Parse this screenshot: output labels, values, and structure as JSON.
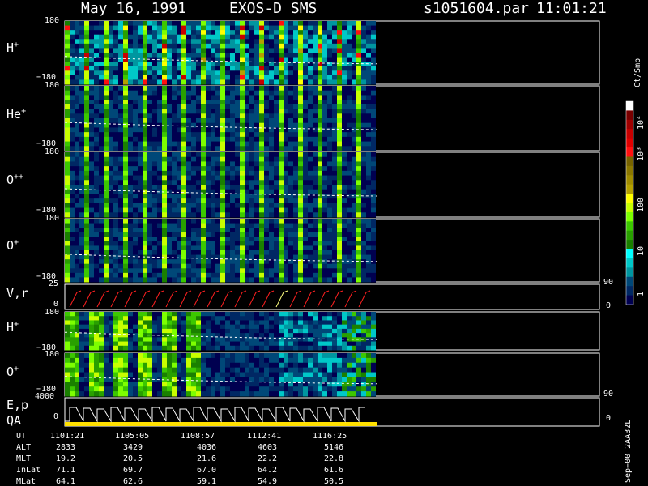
{
  "header": {
    "date": "May 16, 1991",
    "instrument": "EXOS-D SMS",
    "file": "s1051604.par",
    "time": "11:01:21"
  },
  "panels": [
    {
      "id": "h1",
      "ion": "H",
      "charge": "+",
      "top_tick": "180",
      "bottom_tick": "−180"
    },
    {
      "id": "he",
      "ion": "He",
      "charge": "+",
      "top_tick": "180",
      "bottom_tick": "−180"
    },
    {
      "id": "opp",
      "ion": "O",
      "charge": "++",
      "top_tick": "180",
      "bottom_tick": "−180"
    },
    {
      "id": "o1",
      "ion": "O",
      "charge": "+",
      "top_tick": "180",
      "bottom_tick": "−180"
    },
    {
      "id": "vr",
      "ion": "V,r",
      "charge": "",
      "top_tick": "25",
      "bottom_tick": "0",
      "right_top": "90",
      "right_bottom": "0"
    },
    {
      "id": "h2",
      "ion": "H",
      "charge": "+",
      "top_tick": "180",
      "bottom_tick": "−180"
    },
    {
      "id": "o2",
      "ion": "O",
      "charge": "+",
      "top_tick": "180",
      "bottom_tick": "−180",
      "right_bottom": "90"
    },
    {
      "id": "ep",
      "ion": "E,p",
      "ion2": "QA",
      "charge": "",
      "top_tick": "4000",
      "bottom_tick": "0",
      "right_bottom": "0"
    }
  ],
  "colorbar": {
    "unit": "Ct/Smp",
    "labels": [
      "10⁴",
      "10³",
      "100",
      "10",
      "1"
    ],
    "colors": [
      "#ffffff",
      "#7a0000",
      "#a00000",
      "#c80000",
      "#e00000",
      "#ff1010",
      "#786400",
      "#8c7800",
      "#a08c00",
      "#b4a000",
      "#ffff00",
      "#c8ff00",
      "#7dff00",
      "#3cc800",
      "#29a000",
      "#1a8000",
      "#00ffff",
      "#00c8c8",
      "#0096a0",
      "#004878",
      "#002864",
      "#000050"
    ]
  },
  "footer": {
    "version": "Sep−00  2AA32L",
    "table": {
      "row_labels": [
        "UT",
        "ALT",
        "MLT",
        "InLat",
        "MLat"
      ],
      "columns": [
        [
          "1101:21",
          "2833",
          "19.2",
          "71.1",
          "64.1"
        ],
        [
          "1105:05",
          "3429",
          "20.5",
          "69.7",
          "62.6"
        ],
        [
          "1108:57",
          "4036",
          "21.6",
          "67.0",
          "59.1"
        ],
        [
          "1112:41",
          "4603",
          "22.2",
          "64.2",
          "54.9"
        ],
        [
          "1116:25",
          "5146",
          "22.8",
          "61.6",
          "50.5"
        ]
      ]
    }
  },
  "chart_data": {
    "type": "heatmap",
    "panels": [
      "H+",
      "He+",
      "O++",
      "O+",
      "V,r",
      "H+",
      "O+",
      "E,p QA"
    ],
    "x_tick_labels": [
      "1101:21",
      "1105:05",
      "1108:57",
      "1112:41",
      "1116:25"
    ],
    "y_range_pitch_angle": [
      -180,
      180
    ],
    "vr_range": [
      0,
      25
    ],
    "ep_range": [
      0,
      4000
    ],
    "colorbar_range": [
      1,
      10000
    ],
    "colorbar_scale": "log"
  }
}
